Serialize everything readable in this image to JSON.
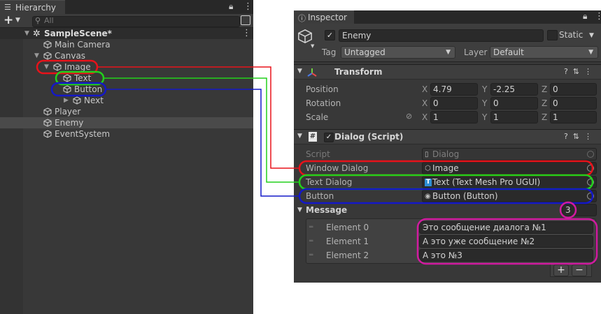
{
  "hierarchy": {
    "tab_label": "Hierarchy",
    "add_label": "+",
    "search_placeholder": "All",
    "scene": "SampleScene*",
    "items": [
      {
        "label": "Main Camera"
      },
      {
        "label": "Canvas"
      },
      {
        "label": "Image"
      },
      {
        "label": "Text"
      },
      {
        "label": "Button"
      },
      {
        "label": "Next"
      },
      {
        "label": "Player"
      },
      {
        "label": "Enemy"
      },
      {
        "label": "EventSystem"
      }
    ]
  },
  "inspector": {
    "tab_label": "Inspector",
    "object_name": "Enemy",
    "static_label": "Static",
    "tag_label": "Tag",
    "tag_value": "Untagged",
    "layer_label": "Layer",
    "layer_value": "Default",
    "transform": {
      "title": "Transform",
      "position_label": "Position",
      "rotation_label": "Rotation",
      "scale_label": "Scale",
      "position": {
        "x": "4.79",
        "y": "-2.25",
        "z": "0"
      },
      "rotation": {
        "x": "0",
        "y": "0",
        "z": "0"
      },
      "scale": {
        "x": "1",
        "y": "1",
        "z": "1"
      },
      "axis_x": "X",
      "axis_y": "Y",
      "axis_z": "Z"
    },
    "dialog": {
      "title": "Dialog (Script)",
      "script_label": "Script",
      "script_value": "Dialog",
      "window_label": "Window Dialog",
      "window_value": "Image",
      "text_label": "Text Dialog",
      "text_value": "Text (Text Mesh Pro UGUI)",
      "button_label": "Button",
      "button_value": "Button (Button)",
      "message_label": "Message",
      "message_count": "3",
      "elements": [
        {
          "label": "Element 0",
          "value": "Это сообщение диалога №1"
        },
        {
          "label": "Element 1",
          "value": "А это уже сообщение №2"
        },
        {
          "label": "Element 2",
          "value": "А это №3"
        }
      ],
      "add_label": "+",
      "remove_label": "−"
    }
  },
  "annotation_colors": {
    "red": "#e8121a",
    "green": "#22d11b",
    "blue": "#1418c8",
    "magenta": "#d11aa0"
  }
}
